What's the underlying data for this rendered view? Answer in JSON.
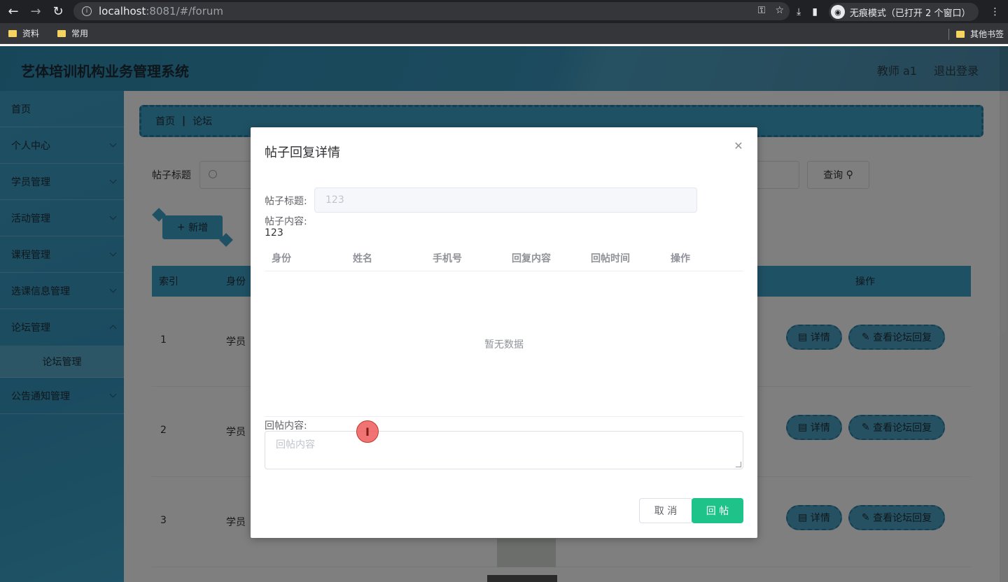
{
  "browser": {
    "url_host": "localhost",
    "url_path": ":8081/#/forum",
    "incognito_label": "无痕模式（已打开 2 个窗口）",
    "bookmarks": [
      "资料",
      "常用"
    ],
    "other_bookmarks": "其他书签"
  },
  "header": {
    "title": "艺体培训机构业务管理系统",
    "user": "教师 a1",
    "logout": "退出登录"
  },
  "sidebar": {
    "items": [
      {
        "label": "首页"
      },
      {
        "label": "个人中心"
      },
      {
        "label": "学员管理"
      },
      {
        "label": "活动管理"
      },
      {
        "label": "课程管理"
      },
      {
        "label": "选课信息管理"
      },
      {
        "label": "论坛管理"
      },
      {
        "label": "公告通知管理"
      }
    ],
    "sub_item": "论坛管理"
  },
  "main": {
    "breadcrumb": {
      "home": "首页",
      "sep": "|",
      "current": "论坛"
    },
    "search_label": "帖子标题",
    "query_button": "查询",
    "add_button": "新增",
    "table": {
      "headers": [
        "索引",
        "身份",
        "操作"
      ],
      "rows": [
        {
          "index": "1",
          "role": "学员"
        },
        {
          "index": "2",
          "role": "学员"
        },
        {
          "index": "3",
          "role": "学员"
        }
      ],
      "detail_btn": "详情",
      "view_reply_btn": "查看论坛回复"
    }
  },
  "dialog": {
    "title": "帖子回复详情",
    "title_label": "帖子标题:",
    "title_value": "123",
    "content_label": "帖子内容:",
    "content_value": "123",
    "columns": [
      "身份",
      "姓名",
      "手机号",
      "回复内容",
      "回帖时间",
      "操作"
    ],
    "empty_text": "暂无数据",
    "reply_label": "回帖内容:",
    "reply_placeholder": "回帖内容",
    "cancel": "取 消",
    "submit": "回 帖"
  }
}
